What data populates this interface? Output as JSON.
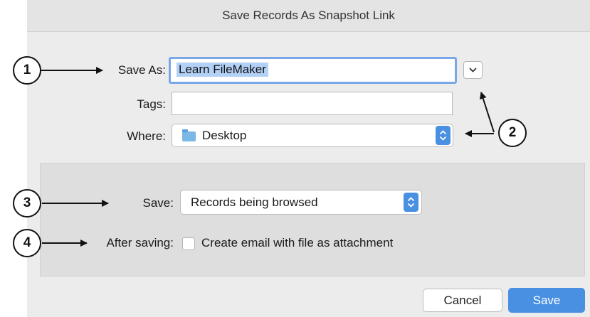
{
  "dialog": {
    "title": "Save Records As Snapshot Link",
    "save_as": {
      "label": "Save As:",
      "value": "Learn FileMaker"
    },
    "expand_icon": "chevron-down-icon",
    "tags": {
      "label": "Tags:",
      "value": ""
    },
    "where": {
      "label": "Where:",
      "value": "Desktop",
      "icon": "folder-icon"
    },
    "save": {
      "label": "Save:",
      "value": "Records being browsed"
    },
    "after_saving": {
      "label": "After saving:",
      "checkbox_label": "Create email with file as attachment",
      "checked": false
    },
    "buttons": {
      "cancel": "Cancel",
      "save": "Save"
    },
    "colors": {
      "accent": "#4a90e2",
      "focus_ring": "#7aa7e6"
    }
  },
  "callouts": [
    "1",
    "2",
    "3",
    "4"
  ]
}
